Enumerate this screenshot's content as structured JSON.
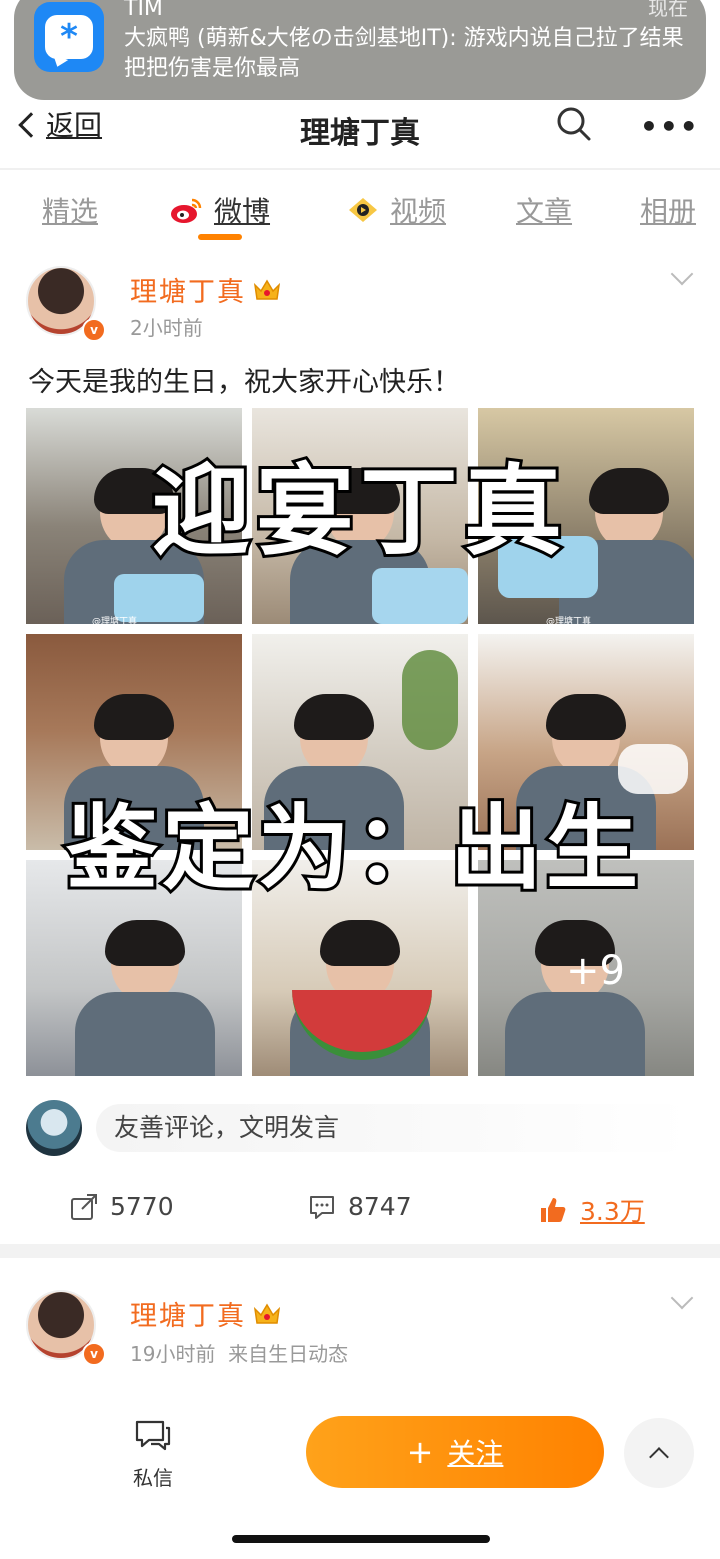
{
  "notification": {
    "app": "TIM",
    "time": "现在",
    "text": "大疯鸭 (萌新&大佬の击剑基地IT): 游戏内说自己拉了结果把把伤害是你最高",
    "icon": "tim-icon"
  },
  "header": {
    "back_label": "返回",
    "title": "理塘丁真"
  },
  "tabs": [
    {
      "label": "精选"
    },
    {
      "label": "微博"
    },
    {
      "label": "视频"
    },
    {
      "label": "文章"
    },
    {
      "label": "相册"
    }
  ],
  "active_tab": "微博",
  "post1": {
    "username": "理塘丁真",
    "time": "2小时前",
    "text": "今天是我的生日，祝大家开心快乐！",
    "overlay_top": "迎宴丁真",
    "overlay_bottom": "鉴定为：出生",
    "more_images": "+9",
    "watermark": "@理塘丁真"
  },
  "comment": {
    "placeholder": "友善评论，文明发言"
  },
  "actions": {
    "repost": "5770",
    "comment": "8747",
    "like": "3.3万"
  },
  "post2": {
    "username": "理塘丁真",
    "time": "19小时前",
    "source": "来自生日动态"
  },
  "bottom": {
    "dm_label": "私信",
    "follow_label": "关注"
  },
  "colors": {
    "accent": "#ff8200",
    "username": "#f26b1f",
    "tim_blue": "#1e88f5"
  }
}
